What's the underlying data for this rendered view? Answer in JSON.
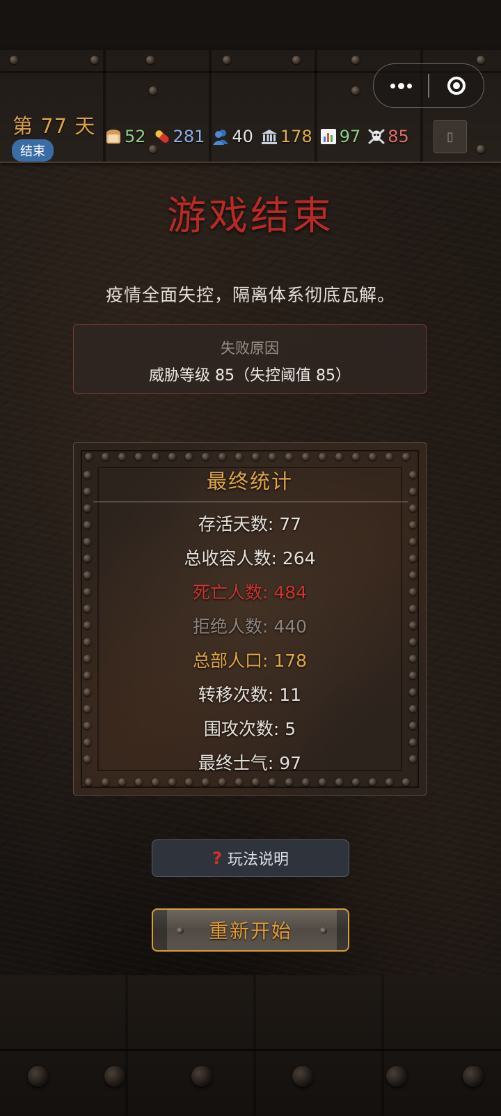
{
  "header": {
    "day_label": "第 77 天",
    "status_badge": "结束",
    "info_glyph": "▯"
  },
  "stats": [
    {
      "icon": "bread-icon",
      "value": "52",
      "color": "#8fd18a"
    },
    {
      "icon": "pill-icon",
      "value": "281",
      "color": "#8ab4e8"
    },
    {
      "icon": "people-icon",
      "value": "40",
      "color": "#e6e6e6"
    },
    {
      "icon": "bank-icon",
      "value": "178",
      "color": "#e0b04f"
    },
    {
      "icon": "bar-chart-icon",
      "value": "97",
      "color": "#8fd18a"
    },
    {
      "icon": "skull-crossbones-icon",
      "value": "85",
      "color": "#e0706c"
    }
  ],
  "main": {
    "title": "游戏结束",
    "message": "疫情全面失控，隔离体系彻底瓦解。",
    "failure": {
      "title": "失败原因",
      "text": "威胁等级 85（失控阈值 85）"
    }
  },
  "final_stats": {
    "title": "最终统计",
    "rows": [
      {
        "text": "存活天数: 77",
        "color": "#e6e0da"
      },
      {
        "text": "总收容人数: 264",
        "color": "#e6e0da"
      },
      {
        "text": "死亡人数: 484",
        "color": "#c7362f"
      },
      {
        "text": "拒绝人数: 440",
        "color": "#8e8680"
      },
      {
        "text": "总部人口: 178",
        "color": "#e0a648"
      },
      {
        "text": "转移次数: 11",
        "color": "#e6e0da"
      },
      {
        "text": "围攻次数: 5",
        "color": "#e6e0da"
      },
      {
        "text": "最终士气: 97",
        "color": "#e6e0da"
      }
    ]
  },
  "actions": {
    "help_label": "玩法说明",
    "help_icon": "question-mark-icon",
    "restart_label": "重新开始"
  },
  "colors": {
    "title_red": "#b82a26",
    "gold": "#e0a648",
    "badge_blue": "#3a6da6"
  }
}
